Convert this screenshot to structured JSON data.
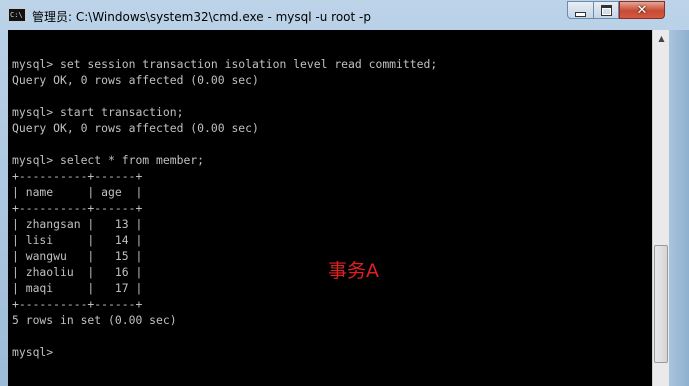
{
  "window": {
    "title": "管理员: C:\\Windows\\system32\\cmd.exe - mysql  -u root -p",
    "icon_label": "C:\\",
    "minimize_icon": "minimize-icon",
    "maximize_icon": "maximize-icon",
    "close_symbol": "✕"
  },
  "console": {
    "lines": [
      "",
      "mysql> set session transaction isolation level read committed;",
      "Query OK, 0 rows affected (0.00 sec)",
      "",
      "mysql> start transaction;",
      "Query OK, 0 rows affected (0.00 sec)",
      "",
      "mysql> select * from member;",
      "+----------+------+",
      "| name     | age  |",
      "+----------+------+",
      "| zhangsan |   13 |",
      "| lisi     |   14 |",
      "| wangwu   |   15 |",
      "| zhaoliu  |   16 |",
      "| maqi     |   17 |",
      "+----------+------+",
      "5 rows in set (0.00 sec)",
      "",
      "mysql>"
    ]
  },
  "scrollbar": {
    "up_arrow": "▲"
  },
  "annotation": {
    "text": "事务A",
    "color": "#e02020"
  }
}
